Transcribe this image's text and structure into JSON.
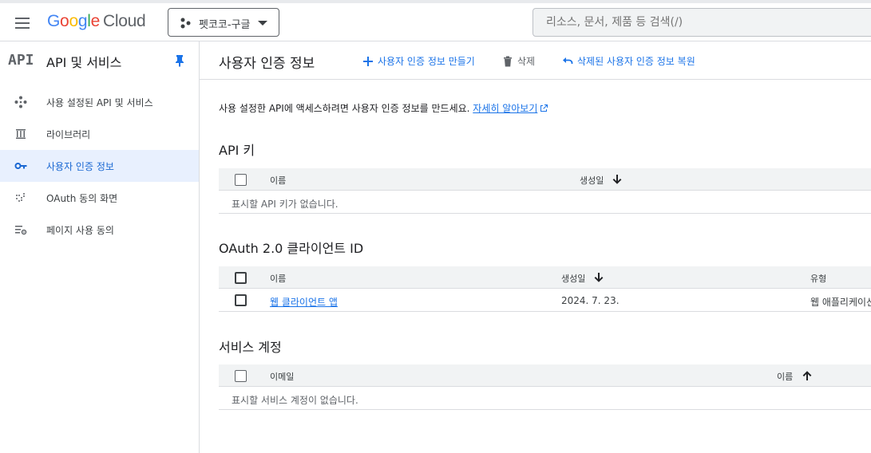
{
  "header": {
    "logo_letters": [
      "G",
      "o",
      "o",
      "g",
      "l",
      "e"
    ],
    "logo_cloud": "Cloud",
    "project_name": "펫코코-구글",
    "search_placeholder": "리소스, 문서, 제품 등 검색(/)"
  },
  "sidebar": {
    "logo_text": "API",
    "title": "API 및 서비스",
    "items": [
      {
        "label": "사용 설정된 API 및 서비스",
        "icon": "diamond-dots-icon"
      },
      {
        "label": "라이브러리",
        "icon": "library-icon"
      },
      {
        "label": "사용자 인증 정보",
        "icon": "key-icon",
        "active": true
      },
      {
        "label": "OAuth 동의 화면",
        "icon": "oauth-dots-icon"
      },
      {
        "label": "페이지 사용 동의",
        "icon": "settings-list-icon"
      }
    ]
  },
  "main": {
    "title": "사용자 인증 정보",
    "actions": {
      "create": "사용자 인증 정보 만들기",
      "delete": "삭제",
      "restore": "삭제된 사용자 인증 정보 복원"
    },
    "intro_text": "사용 설정한 API에 액세스하려면 사용자 인증 정보를 만드세요. ",
    "learn_more": "자세히 알아보기",
    "api_keys": {
      "title": "API 키",
      "col_name": "이름",
      "col_created": "생성일",
      "empty": "표시할 API 키가 없습니다."
    },
    "oauth": {
      "title": "OAuth 2.0 클라이언트 ID",
      "col_name": "이름",
      "col_created": "생성일",
      "col_type": "유형",
      "rows": [
        {
          "name": "웹 클라이언트 앱",
          "created": "2024. 7. 23.",
          "type": "웹 애플리케이션"
        }
      ]
    },
    "service_accounts": {
      "title": "서비스 계정",
      "col_email": "이메일",
      "col_name": "이름",
      "empty": "표시할 서비스 계정이 없습니다."
    }
  },
  "colors": {
    "accent": "#1a73e8",
    "active_bg": "#e8f0fe",
    "header_bg": "#f1f3f4",
    "divider": "#dadce0"
  }
}
